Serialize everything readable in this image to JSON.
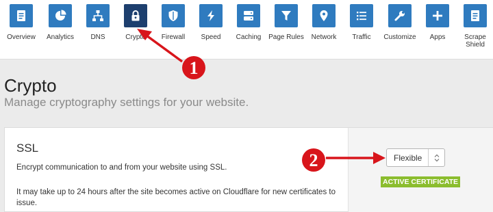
{
  "nav": {
    "items": [
      {
        "label": "Overview",
        "icon": "document-icon"
      },
      {
        "label": "Analytics",
        "icon": "pie-chart-icon"
      },
      {
        "label": "DNS",
        "icon": "network-tree-icon"
      },
      {
        "label": "Crypto",
        "icon": "lock-icon",
        "active": true
      },
      {
        "label": "Firewall",
        "icon": "shield-icon"
      },
      {
        "label": "Speed",
        "icon": "lightning-icon"
      },
      {
        "label": "Caching",
        "icon": "server-icon"
      },
      {
        "label": "Page Rules",
        "icon": "filter-icon"
      },
      {
        "label": "Network",
        "icon": "location-pin-icon"
      },
      {
        "label": "Traffic",
        "icon": "list-icon"
      },
      {
        "label": "Customize",
        "icon": "wrench-icon"
      },
      {
        "label": "Apps",
        "icon": "plus-icon"
      },
      {
        "label": "Scrape Shield",
        "icon": "document-icon"
      }
    ]
  },
  "page": {
    "title": "Crypto",
    "subtitle": "Manage cryptography settings for your website."
  },
  "ssl": {
    "title": "SSL",
    "description": "Encrypt communication to and from your website using SSL.",
    "note": "It may take up to 24 hours after the site becomes active on Cloudflare for new certificates to issue.",
    "selected_mode": "Flexible",
    "badge": "ACTIVE CERTIFICATE"
  },
  "annotations": {
    "callout_1": "1",
    "callout_2": "2"
  },
  "colors": {
    "nav_tile": "#2f7bbf",
    "nav_tile_active": "#1d3f6e",
    "badge": "#8bbd2e",
    "annotation": "#d8151b"
  }
}
